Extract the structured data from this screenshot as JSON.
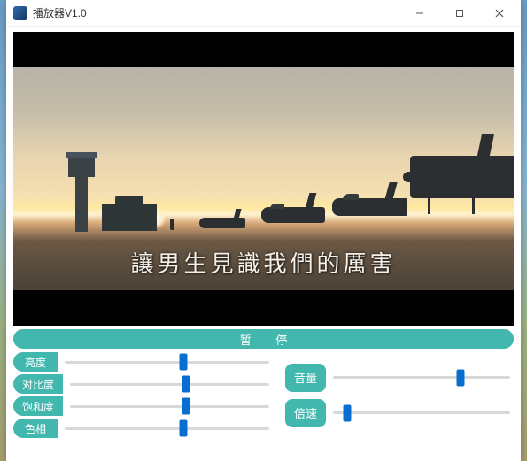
{
  "window": {
    "title": "播放器V1.0"
  },
  "video": {
    "subtitle": "讓男生見識我們的厲害"
  },
  "controls": {
    "pause_label": "暂  停",
    "left": [
      {
        "label": "亮度",
        "pct": 58
      },
      {
        "label": "对比度",
        "pct": 58
      },
      {
        "label": "饱和度",
        "pct": 58
      },
      {
        "label": "色相",
        "pct": 58
      }
    ],
    "right": [
      {
        "label": "音量",
        "pct": 72
      },
      {
        "label": "倍速",
        "pct": 8
      }
    ]
  },
  "colors": {
    "accent": "#41b7ae",
    "slider_thumb": "#0a6ed1"
  }
}
